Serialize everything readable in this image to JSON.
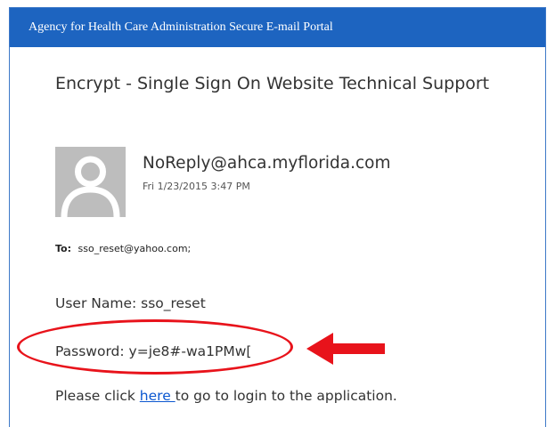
{
  "header": {
    "title": "Agency for Health Care Administration Secure E-mail Portal"
  },
  "email": {
    "subject": "Encrypt - Single Sign On Website Technical Support",
    "sender": "NoReply@ahca.myflorida.com",
    "sent_date": "Fri 1/23/2015 3:47 PM",
    "to_label": "To:",
    "to_address": "sso_reset@yahoo.com;",
    "body": {
      "user_name_line": "User Name: sso_reset",
      "password_line": "Password: y=je8#-wa1PMw[",
      "click_prefix": "Please click ",
      "link_text": "here ",
      "click_suffix": "to go to login to the application."
    }
  },
  "annotation": {
    "color": "#e8131b",
    "icons": [
      "red-ellipse-highlight",
      "red-arrow-icon"
    ]
  },
  "colors": {
    "header_bg": "#1d64c0",
    "link": "#0b57d0",
    "avatar_bg": "#bdbdbd"
  }
}
